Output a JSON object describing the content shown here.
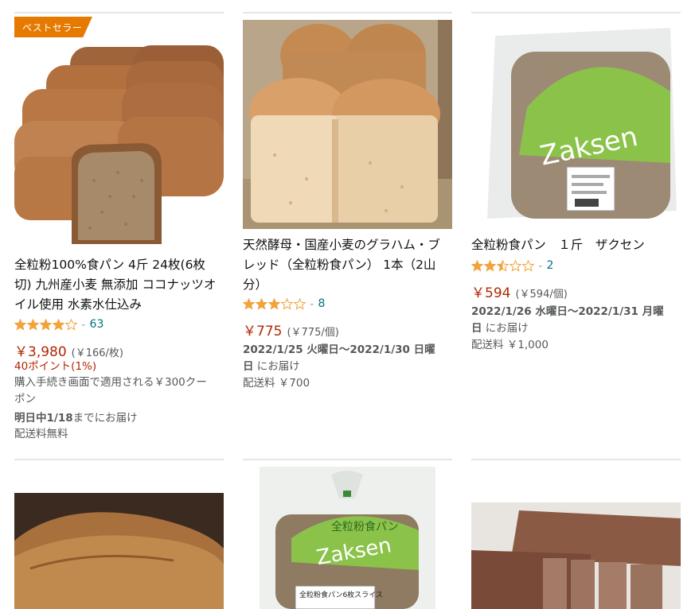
{
  "colors": {
    "accent_price": "#B12704",
    "link": "#007185",
    "badge": "#e67a00",
    "star": "#F2A33A"
  },
  "products": [
    {
      "badge": "ベストセラー",
      "title_lines": [
        "全粒粉100%食パン 4斤 24枚(6枚",
        "切) 九州産小麦 無添加 ココナッツオ",
        "イル使用 水素水仕込み"
      ],
      "rating": 4.0,
      "rating_count": "63",
      "price": "￥3,980",
      "unit_price": "(￥166/枚)",
      "points": "40ポイント(1%)",
      "coupon_lines": [
        "購入手続き画面で適用される￥300クー",
        "ポン"
      ],
      "delivery_bold": "明日中1/18",
      "delivery_rest": "までにお届け",
      "shipping": "配送料無料"
    },
    {
      "title_lines": [
        "天然酵母・国産小麦のグラハム・ブ",
        "レッド（全粒粉食パン） 1本（2山",
        "分）"
      ],
      "rating": 3.0,
      "rating_count": "8",
      "price": "￥775",
      "unit_price": "(￥775/個)",
      "delivery_line1": "2022/1/25 火曜日〜2022/1/30 日曜",
      "delivery_line2_bold": "日",
      "delivery_line2_rest": " にお届け",
      "shipping": "配送料 ￥700"
    },
    {
      "title_lines": [
        "全粒粉食パン　１斤　ザクセン"
      ],
      "rating": 2.5,
      "rating_count": "2",
      "price": "￥594",
      "unit_price": "(￥594/個)",
      "delivery_line1": "2022/1/26 水曜日〜2022/1/31 月曜",
      "delivery_line2_bold": "日",
      "delivery_line2_rest": " にお届け",
      "shipping": "配送料 ￥1,000"
    }
  ],
  "second_row": {
    "package_label": "全粒粉食パン6枚スライス",
    "package_brand": "Zaksen",
    "package_green_text": "全粒粉食パン"
  },
  "first_row": {
    "package_brand": "Zaksen"
  }
}
